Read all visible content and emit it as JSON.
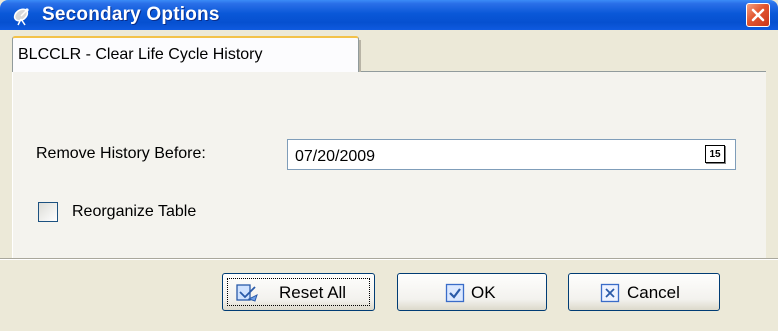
{
  "window": {
    "title": "Secondary Options",
    "title_icon": "satellite-dish-icon",
    "close_icon": "close-icon"
  },
  "tabs": [
    {
      "label": "BLCCLR - Clear Life Cycle History",
      "selected": true
    }
  ],
  "form": {
    "remove_history_label": "Remove History Before:",
    "remove_history_value": "07/20/2009",
    "calendar_button": {
      "icon": "calendar-icon",
      "text": "15"
    },
    "reorganize_label": "Reorganize Table",
    "reorganize_checked": false
  },
  "buttons": {
    "reset_all": {
      "label": "Reset All",
      "icon": "reset-icon"
    },
    "ok": {
      "label": "OK",
      "icon": "check-icon"
    },
    "cancel": {
      "label": "Cancel",
      "icon": "cancel-x-icon"
    }
  },
  "colors": {
    "titlebar": "#0a58d8",
    "window_bg": "#ece9d8",
    "close_button": "#e2552f",
    "tab_highlight": "#f3c24a",
    "button_border": "#003c74"
  }
}
